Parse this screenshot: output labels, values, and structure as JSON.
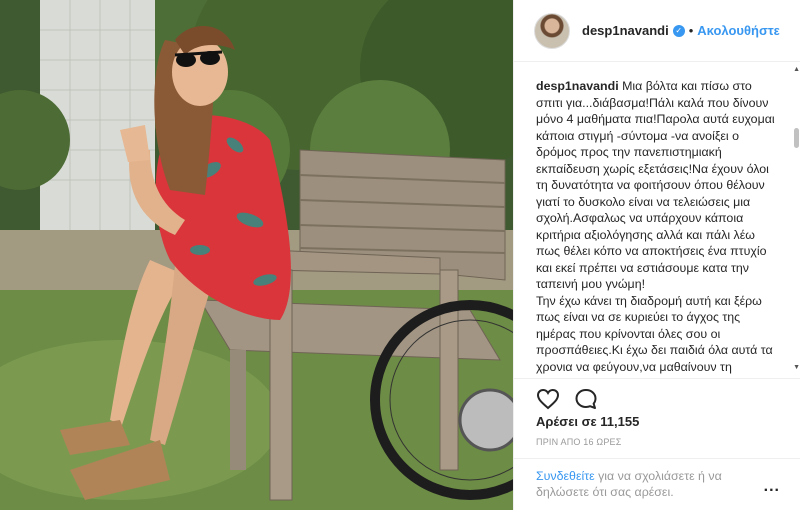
{
  "post": {
    "username": "desp1navandi",
    "separator": "•",
    "follow_label": "Ακολουθήστε",
    "caption_user": "desp1navandi",
    "caption_text": "Μια βόλτα και πίσω στο σπιτι για...διάβασμα!Πάλι καλά που δίνουν μόνο 4 μαθήματα πια!Παρολα αυτά ευχομαι κάποια στιγμή -σύντομα -να ανοίξει ο δρόμος προς την πανεπιστημιακή εκπαίδευση χωρίς εξετάσεις!Να έχουν όλοι τη δυνατότητα να φοιτήσουν όπου θέλουν γιατί το δυσκολο είναι να τελειώσεις μια σχολή.Ασφαλως να υπάρχουν κάποια κριτήρια αξιολόγησης αλλά και πάλι λέω πως θέλει κόπο να αποκτήσεις ένα πτυχίο και εκεί πρέπει να εστιάσουμε κατα την ταπεινή μου γνώμη!",
    "caption_text_2": "Την έχω κάνει τη διαδρομή αυτή και ξέρω πως είναι να σε κυριεύει το άγχος της ημέρας που κρίνονται όλες σου οι προσπάθειες.Κι έχω δει παιδιά όλα αυτά τα χρονια να φεύγουν,να μαθαίνουν τη γλώσσα της χώρας που πάνε(και δεν αναφέρομαι σε αυτούς που είναι επιλογή",
    "likes": "Αρέσει σε 11,155",
    "time_ago": "ΠΡΙΝ ΑΠΟ 16 ΩΡΕΣ",
    "login_link": "Συνδεθείτε",
    "login_text": " για να σχολιάσετε ή να δηλώσετε ότι σας αρέσει.",
    "more_label": "..."
  },
  "icons": {
    "verified": "verified-badge-icon",
    "like": "heart-icon",
    "comment": "comment-icon",
    "more": "more-options-icon"
  },
  "colors": {
    "accent": "#3897f0",
    "text": "#262626",
    "muted": "#999999",
    "border": "#efefef"
  }
}
